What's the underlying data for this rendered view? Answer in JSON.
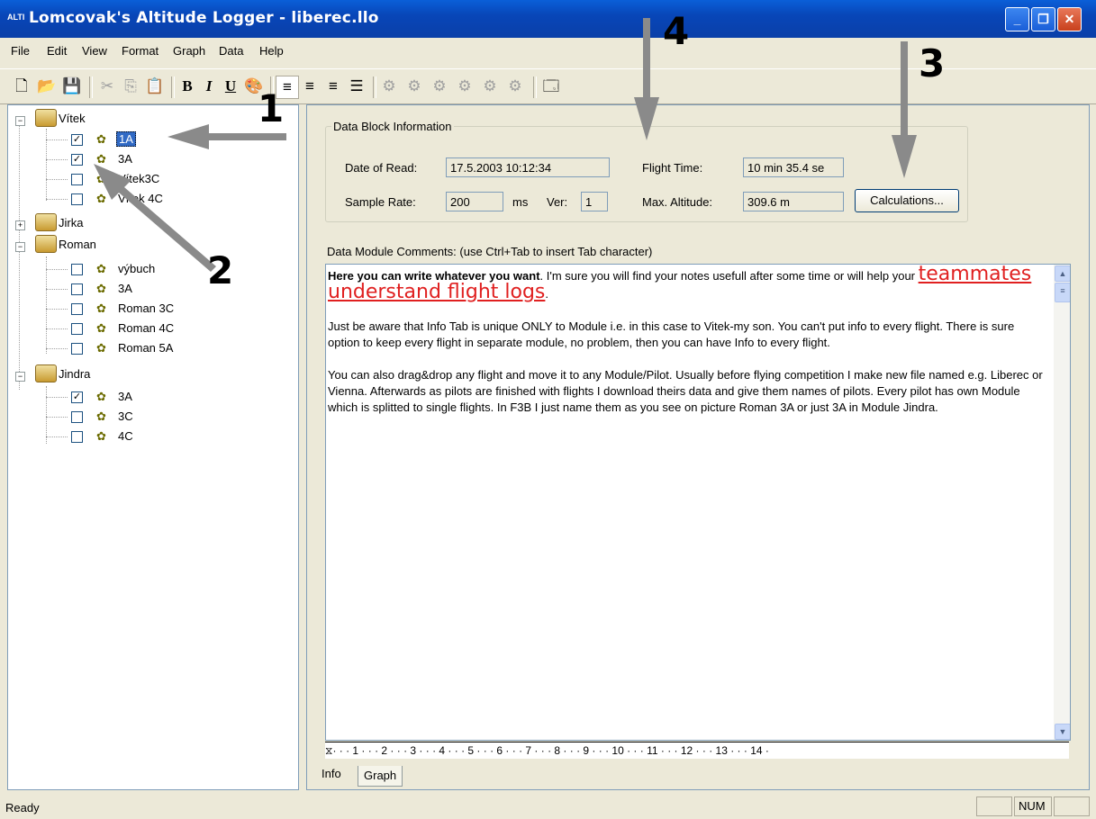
{
  "window": {
    "app_icon_text": "ALTI",
    "title": "Lomcovak's Altitude Logger - liberec.llo",
    "buttons": {
      "minimize": "_",
      "restore": "❐",
      "close": "✕"
    }
  },
  "menu": [
    "File",
    "Edit",
    "View",
    "Format",
    "Graph",
    "Data",
    "Help"
  ],
  "toolbar": {
    "icons": [
      "new-file-icon",
      "open-folder-icon",
      "save-icon",
      "cut-icon",
      "copy-icon",
      "paste-icon",
      "bold-icon",
      "italic-icon",
      "underline-icon",
      "color-icon",
      "align-left-icon",
      "align-center-icon",
      "align-right-icon",
      "bullets-icon",
      "flight-icon-1",
      "flight-icon-2",
      "flight-icon-3",
      "flight-icon-4",
      "flight-icon-5",
      "flight-icon-6",
      "properties-icon"
    ]
  },
  "tree": {
    "groups": [
      {
        "name": "Vítek",
        "expanded": true,
        "items": [
          {
            "label": "1A",
            "checked": true,
            "selected": true
          },
          {
            "label": "3A",
            "checked": true
          },
          {
            "label": "Vítek3C",
            "checked": false
          },
          {
            "label": "Vítek 4C",
            "checked": false
          }
        ]
      },
      {
        "name": "Jirka",
        "expanded": false,
        "items": []
      },
      {
        "name": "Roman",
        "expanded": true,
        "items": [
          {
            "label": "výbuch",
            "checked": false
          },
          {
            "label": "3A",
            "checked": false
          },
          {
            "label": "Roman 3C",
            "checked": false
          },
          {
            "label": "Roman 4C",
            "checked": false
          },
          {
            "label": "Roman 5A",
            "checked": false
          }
        ]
      },
      {
        "name": "Jindra",
        "expanded": true,
        "items": [
          {
            "label": "3A",
            "checked": true
          },
          {
            "label": "3C",
            "checked": false
          },
          {
            "label": "4C",
            "checked": false
          }
        ]
      }
    ]
  },
  "info": {
    "legend": "Data Block Information",
    "date_label": "Date of Read:",
    "date_value": "17.5.2003 10:12:34",
    "rate_label": "Sample Rate:",
    "rate_value": "200",
    "rate_unit": "ms",
    "ver_label": "Ver:",
    "ver_value": "1",
    "flight_time_label": "Flight Time:",
    "flight_time_value": "10 min 35.4 se",
    "max_alt_label": "Max. Altitude:",
    "max_alt_value": "309.6 m",
    "calc_button": "Calculations..."
  },
  "comments": {
    "label": "Data Module Comments: (use Ctrl+Tab to insert Tab character)",
    "bold_intro": "Here you can write whatever you want",
    "intro_rest": ". I'm sure you will find your notes usefull after some time or will help your ",
    "highlight": "teammates understand flight logs",
    "highlight_end": ".",
    "para2": "Just be aware that Info Tab is unique ONLY to Module i.e. in this case to Vitek-my son. You can't put info to every flight. There is sure option to keep every flight in separate module, no problem, then you can have Info to every flight.",
    "para3": "You can also drag&drop any flight and move it to any Module/Pilot. Usually before flying competition I make new file named e.g. Liberec or Vienna. Afterwards as pilots are finished with flights I download theirs data and give them names of pilots. Every pilot has own Module which is splitted to single flights. In F3B I just name them as you see on picture Roman 3A or just 3A in Module Jindra."
  },
  "ruler": "· · · 1 · · · 2 · · · 3 · · · 4 · · · 5 · · · 6 · · · 7 · · · 8 · · · 9 · · · 10 · · · 11 · · · 12 · · · 13 · · · 14 ·",
  "tabs": {
    "info": "Info",
    "graph": "Graph"
  },
  "status": {
    "text": "Ready",
    "num": "NUM"
  },
  "annotations": {
    "a1": "1",
    "a2": "2",
    "a3": "3",
    "a4": "4"
  }
}
